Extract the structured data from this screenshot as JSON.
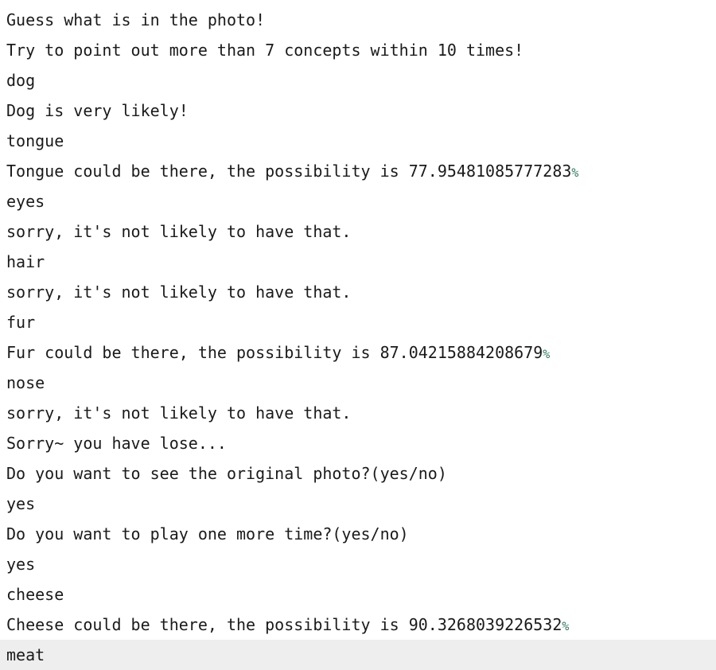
{
  "console": {
    "lines": [
      {
        "kind": "output",
        "text": "Guess what is in the photo!"
      },
      {
        "kind": "output",
        "text": "Try to point out more than 7 concepts within 10 times!"
      },
      {
        "kind": "input",
        "text": "dog"
      },
      {
        "kind": "output",
        "text": "Dog is very likely!"
      },
      {
        "kind": "input",
        "text": "tongue"
      },
      {
        "kind": "output",
        "text": "Tongue could be there, the possibility is 77.95481085777283",
        "suffix": "%"
      },
      {
        "kind": "input",
        "text": "eyes"
      },
      {
        "kind": "output",
        "text": "sorry, it's not likely to have that."
      },
      {
        "kind": "input",
        "text": "hair"
      },
      {
        "kind": "output",
        "text": "sorry, it's not likely to have that."
      },
      {
        "kind": "input",
        "text": "fur"
      },
      {
        "kind": "output",
        "text": "Fur could be there, the possibility is 87.04215884208679",
        "suffix": "%"
      },
      {
        "kind": "input",
        "text": "nose"
      },
      {
        "kind": "output",
        "text": "sorry, it's not likely to have that."
      },
      {
        "kind": "output",
        "text": "Sorry~ you have lose..."
      },
      {
        "kind": "output",
        "text": "Do you want to see the original photo?(yes/no)"
      },
      {
        "kind": "input",
        "text": "yes"
      },
      {
        "kind": "output",
        "text": "Do you want to play one more time?(yes/no)"
      },
      {
        "kind": "input",
        "text": "yes"
      },
      {
        "kind": "input",
        "text": "cheese"
      },
      {
        "kind": "output",
        "text": "Cheese could be there, the possibility is 90.3268039226532",
        "suffix": "%"
      }
    ],
    "current_input": "meat"
  },
  "colors": {
    "text": "#1a1a1a",
    "percent": "#2e7d5e",
    "current_line_bg": "#eeeeee"
  }
}
